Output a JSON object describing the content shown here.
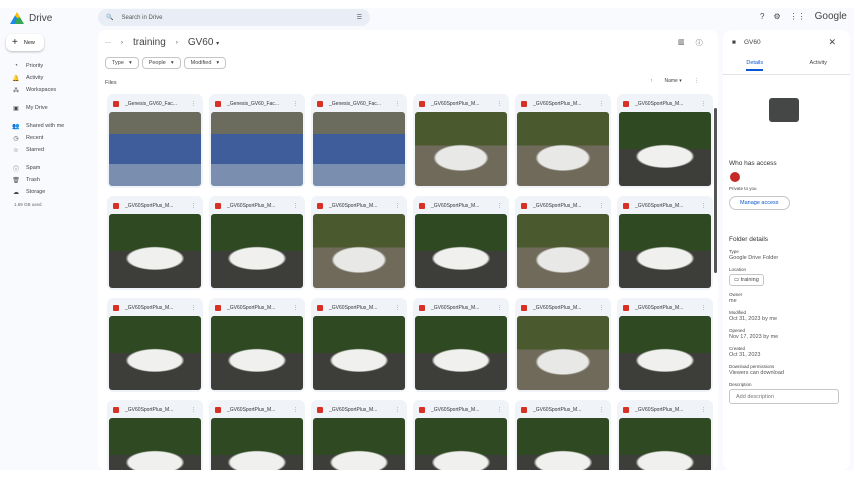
{
  "app": {
    "name": "Drive"
  },
  "search": {
    "placeholder": "Search in Drive"
  },
  "top": {
    "help": "?",
    "settings": "⚙",
    "apps": "⋮⋮",
    "google": "Google"
  },
  "new_label": "New",
  "nav": [
    {
      "icon": "◔",
      "label": "Priority"
    },
    {
      "icon": "🔔",
      "label": "Activity"
    },
    {
      "icon": "⁂",
      "label": "Workspaces"
    },
    {
      "icon": "▣",
      "label": "My Drive"
    },
    {
      "icon": "👥",
      "label": "Shared with me"
    },
    {
      "icon": "◷",
      "label": "Recent"
    },
    {
      "icon": "☆",
      "label": "Starred"
    },
    {
      "icon": "ⓘ",
      "label": "Spam"
    },
    {
      "icon": "🗑",
      "label": "Trash"
    },
    {
      "icon": "☁",
      "label": "Storage"
    }
  ],
  "storage_used": "1.69 GB used",
  "breadcrumb": {
    "more": "···",
    "parent": "training",
    "current": "GV60"
  },
  "filters": [
    "Type",
    "People",
    "Modified"
  ],
  "files_label": "Files",
  "sort": {
    "label": "Name"
  },
  "files": [
    {
      "name": "_Genesis_GV60_Fac...",
      "thumb": "a"
    },
    {
      "name": "_Genesis_GV60_Fac...",
      "thumb": "a"
    },
    {
      "name": "_Genesis_GV60_Fac...",
      "thumb": "a"
    },
    {
      "name": "_GV60SportPlus_M...",
      "thumb": "b"
    },
    {
      "name": "_GV60SportPlus_M...",
      "thumb": "b"
    },
    {
      "name": "_GV60SportPlus_M...",
      "thumb": "c"
    },
    {
      "name": "_GV60SportPlus_M...",
      "thumb": "c"
    },
    {
      "name": "_GV60SportPlus_M...",
      "thumb": "c"
    },
    {
      "name": "_GV60SportPlus_M...",
      "thumb": "b"
    },
    {
      "name": "_GV60SportPlus_M...",
      "thumb": "c"
    },
    {
      "name": "_GV60SportPlus_M...",
      "thumb": "b"
    },
    {
      "name": "_GV60SportPlus_M...",
      "thumb": "c"
    },
    {
      "name": "_GV60SportPlus_M...",
      "thumb": "c"
    },
    {
      "name": "_GV60SportPlus_M...",
      "thumb": "c"
    },
    {
      "name": "_GV60SportPlus_M...",
      "thumb": "c"
    },
    {
      "name": "_GV60SportPlus_M...",
      "thumb": "c"
    },
    {
      "name": "_GV60SportPlus_M...",
      "thumb": "b"
    },
    {
      "name": "_GV60SportPlus_M...",
      "thumb": "c"
    },
    {
      "name": "_GV60SportPlus_M...",
      "thumb": "c"
    },
    {
      "name": "_GV60SportPlus_M...",
      "thumb": "c"
    },
    {
      "name": "_GV60SportPlus_M...",
      "thumb": "c"
    },
    {
      "name": "_GV60SportPlus_M...",
      "thumb": "c"
    },
    {
      "name": "_GV60SportPlus_M...",
      "thumb": "c"
    },
    {
      "name": "_GV60SportPlus_M...",
      "thumb": "c"
    }
  ],
  "details": {
    "title": "GV60",
    "tabs": [
      "Details",
      "Activity"
    ],
    "access_heading": "Who has access",
    "private": "Private to you",
    "manage": "Manage access",
    "folder_heading": "Folder details",
    "fields": [
      {
        "label": "Type",
        "value": "Google Drive Folder"
      },
      {
        "label": "Owner",
        "value": "me"
      },
      {
        "label": "Modified",
        "value": "Oct 31, 2023 by me"
      },
      {
        "label": "Opened",
        "value": "Nov 17, 2023 by me"
      },
      {
        "label": "Created",
        "value": "Oct 31, 2023"
      },
      {
        "label": "Download permissions",
        "value": "Viewers can download"
      }
    ],
    "location_label": "Location",
    "location": "training",
    "description_label": "Description",
    "description_placeholder": "Add description"
  }
}
